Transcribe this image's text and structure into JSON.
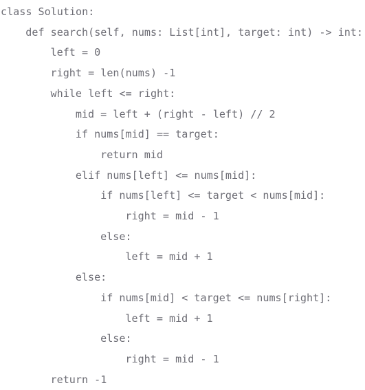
{
  "document": {
    "kind": "code-listing",
    "language": "python",
    "background_color": "#ffffff",
    "text_color": "#6c6c74",
    "font_style": "monospace",
    "line_count": 19,
    "indent_unit_spaces": 4
  },
  "code": {
    "lines": [
      {
        "n": 1,
        "indent": 0,
        "text": "class Solution:"
      },
      {
        "n": 2,
        "indent": 4,
        "text": "def search(self, nums: List[int], target: int) -> int:"
      },
      {
        "n": 3,
        "indent": 8,
        "text": "left = 0"
      },
      {
        "n": 4,
        "indent": 8,
        "text": "right = len(nums) -1"
      },
      {
        "n": 5,
        "indent": 8,
        "text": "while left <= right:"
      },
      {
        "n": 6,
        "indent": 12,
        "text": "mid = left + (right - left) // 2"
      },
      {
        "n": 7,
        "indent": 12,
        "text": "if nums[mid] == target:"
      },
      {
        "n": 8,
        "indent": 16,
        "text": "return mid"
      },
      {
        "n": 9,
        "indent": 12,
        "text": "elif nums[left] <= nums[mid]:"
      },
      {
        "n": 10,
        "indent": 16,
        "text": "if nums[left] <= target < nums[mid]:"
      },
      {
        "n": 11,
        "indent": 20,
        "text": "right = mid - 1"
      },
      {
        "n": 12,
        "indent": 16,
        "text": "else:"
      },
      {
        "n": 13,
        "indent": 20,
        "text": "left = mid + 1"
      },
      {
        "n": 14,
        "indent": 12,
        "text": "else:"
      },
      {
        "n": 15,
        "indent": 16,
        "text": "if nums[mid] < target <= nums[right]:"
      },
      {
        "n": 16,
        "indent": 20,
        "text": "left = mid + 1"
      },
      {
        "n": 17,
        "indent": 16,
        "text": "else:"
      },
      {
        "n": 18,
        "indent": 20,
        "text": "right = mid - 1"
      },
      {
        "n": 19,
        "indent": 8,
        "text": "return -1"
      }
    ]
  }
}
